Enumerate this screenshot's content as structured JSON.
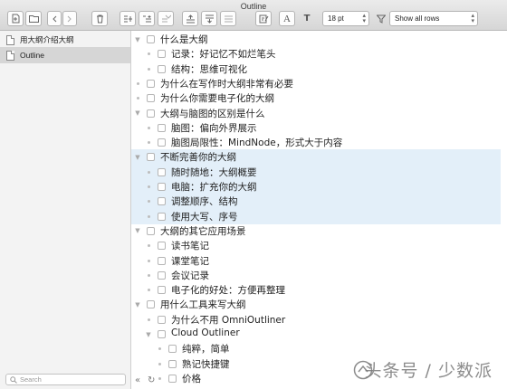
{
  "window": {
    "title": "Outline"
  },
  "toolbar": {
    "font_size": "18 pt",
    "filter_value": "Show all rows",
    "font_label": "A",
    "size_label": "T"
  },
  "sidebar": {
    "items": [
      {
        "label": "用大纲介绍大纲",
        "selected": false
      },
      {
        "label": "Outline",
        "selected": true
      }
    ],
    "search_placeholder": "Search"
  },
  "outline": {
    "rows": [
      {
        "text": "什么是大纲",
        "level": 0,
        "expanded": true,
        "highlight": false
      },
      {
        "text": "记录：好记忆不如烂笔头",
        "level": 1,
        "highlight": false
      },
      {
        "text": "结构：思维可视化",
        "level": 1,
        "highlight": false
      },
      {
        "text": "为什么在写作时大纲非常有必要",
        "level": 0,
        "highlight": false
      },
      {
        "text": "为什么你需要电子化的大纲",
        "level": 0,
        "highlight": false
      },
      {
        "text": "大纲与脑图的区别是什么",
        "level": 0,
        "expanded": true,
        "highlight": false
      },
      {
        "text": "脑图：偏向外界展示",
        "level": 1,
        "highlight": false
      },
      {
        "text": "脑图局限性：MindNode，形式大于内容",
        "level": 1,
        "highlight": false
      },
      {
        "text": "不断完善你的大纲",
        "level": 0,
        "expanded": true,
        "highlight": true
      },
      {
        "text": "随时随地：大纲概要",
        "level": 1,
        "highlight": true
      },
      {
        "text": "电脑：扩充你的大纲",
        "level": 1,
        "highlight": true
      },
      {
        "text": "调整顺序、结构",
        "level": 1,
        "highlight": true
      },
      {
        "text": "使用大写、序号",
        "level": 1,
        "highlight": true
      },
      {
        "text": "大纲的其它应用场景",
        "level": 0,
        "expanded": true,
        "highlight": false
      },
      {
        "text": "读书笔记",
        "level": 1,
        "highlight": false
      },
      {
        "text": "课堂笔记",
        "level": 1,
        "highlight": false
      },
      {
        "text": "会议记录",
        "level": 1,
        "highlight": false
      },
      {
        "text": "电子化的好处：方便再整理",
        "level": 1,
        "highlight": false
      },
      {
        "text": "用什么工具来写大纲",
        "level": 0,
        "expanded": true,
        "highlight": false
      },
      {
        "text": "为什么不用 OmniOutliner",
        "level": 1,
        "highlight": false
      },
      {
        "text": "Cloud Outliner",
        "level": 1,
        "expanded": true,
        "highlight": false
      },
      {
        "text": "纯粹，简单",
        "level": 2,
        "highlight": false
      },
      {
        "text": "熟记快捷键",
        "level": 2,
        "highlight": false
      },
      {
        "text": "价格",
        "level": 2,
        "highlight": false
      }
    ]
  },
  "watermark": {
    "text": "头条号 / 少数派"
  },
  "colors": {
    "highlight": "#e3eff9",
    "selected_sidebar": "#d6d6d6"
  }
}
